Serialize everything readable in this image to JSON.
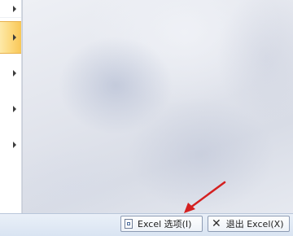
{
  "menu": {
    "items": [
      {
        "name": "menu-item-1",
        "has_submenu": true
      },
      {
        "name": "menu-item-2",
        "has_submenu": true,
        "highlighted": true
      },
      {
        "name": "menu-item-3",
        "has_submenu": true
      },
      {
        "name": "menu-item-4",
        "has_submenu": true
      },
      {
        "name": "menu-item-5",
        "has_submenu": true
      },
      {
        "name": "menu-item-6",
        "has_submenu": true
      }
    ]
  },
  "footer": {
    "options_button": {
      "label": "Excel 选项(I)",
      "icon": "document-icon"
    },
    "exit_button": {
      "label": "退出 Excel(X)",
      "icon": "close-icon"
    }
  },
  "annotation": {
    "arrow_color": "#d42020"
  },
  "colors": {
    "highlight": "#fcd77a",
    "footer_bg": "#dce6f3",
    "button_border": "#8d9bb3"
  }
}
